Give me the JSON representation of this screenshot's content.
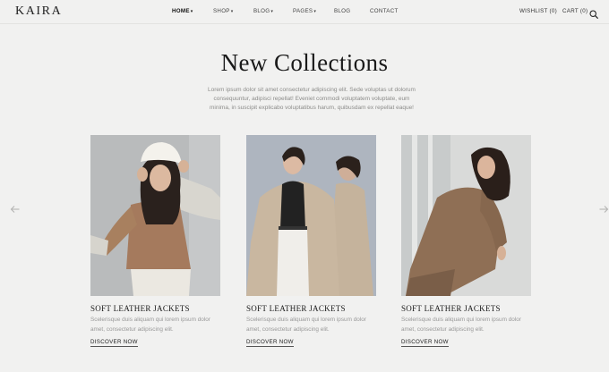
{
  "brand": {
    "logo": "KAIRA"
  },
  "nav": [
    {
      "label": "HOME",
      "dropdown": true,
      "active": true
    },
    {
      "label": "SHOP",
      "dropdown": true,
      "active": false
    },
    {
      "label": "BLOG",
      "dropdown": true,
      "active": false
    },
    {
      "label": "PAGES",
      "dropdown": true,
      "active": false
    },
    {
      "label": "BLOG",
      "dropdown": false,
      "active": false
    },
    {
      "label": "CONTACT",
      "dropdown": false,
      "active": false
    }
  ],
  "header_actions": {
    "wishlist": "WISHLIST (0)",
    "cart": "CART (0)",
    "search_icon": "search-icon"
  },
  "hero": {
    "title": "New Collections",
    "description": "Lorem ipsum dolor sit amet consectetur adipiscing elit. Sede voluptas ut dolorum consequuntur, adipisci repellat! Eveniet commodi voluptatem voluptate, eum minima, in suscipit explicabo voluptatibus harum, quibusdam ex repellat eaque!"
  },
  "carousel": {
    "prev_icon": "arrow-left-icon",
    "next_icon": "arrow-right-icon",
    "items": [
      {
        "title": "SOFT LEATHER JACKETS",
        "description": "Scelerisque duis aliquam qui lorem ipsum dolor amet, consectetur adipiscing elit.",
        "link": "DISCOVER NOW",
        "image": "model in white bucket hat and brown top"
      },
      {
        "title": "SOFT LEATHER JACKETS",
        "description": "Scelerisque duis aliquam qui lorem ipsum dolor amet, consectetur adipiscing elit.",
        "link": "DISCOVER NOW",
        "image": "two models in beige trench coats"
      },
      {
        "title": "SOFT LEATHER JACKETS",
        "description": "Scelerisque duis aliquam qui lorem ipsum dolor amet, consectetur adipiscing elit.",
        "link": "DISCOVER NOW",
        "image": "model in brown plaid blazer"
      }
    ]
  },
  "colors": {
    "background": "#f1f1f0",
    "text_dark": "#1a1a1a",
    "text_muted": "#8c8c8a"
  }
}
